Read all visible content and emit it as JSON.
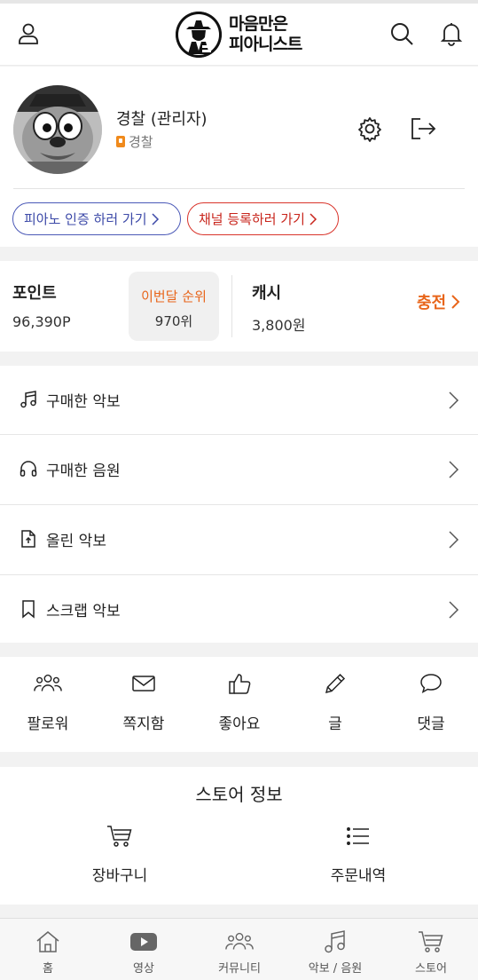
{
  "header": {
    "logo_line1": "마음만은",
    "logo_line2": "피아니스트",
    "icons": [
      "user-icon",
      "search-icon",
      "bell-icon"
    ]
  },
  "profile": {
    "name": "경찰 (관리자)",
    "role": "경찰",
    "pill_piano": "피아노 인증 하러 가기",
    "pill_channel": "채널 등록하러 가기",
    "icons": [
      "gear-icon",
      "logout-icon"
    ]
  },
  "points": {
    "point_label": "포인트",
    "point_value": "96,390P",
    "rank_label": "이번달 순위",
    "rank_value": "970위",
    "cash_label": "캐시",
    "cash_value": "3,800원",
    "charge_label": "충전"
  },
  "menu": {
    "items": [
      {
        "label": "구매한 악보",
        "icon": "music-note-icon"
      },
      {
        "label": "구매한 음원",
        "icon": "headphones-icon"
      },
      {
        "label": "올린 악보",
        "icon": "upload-file-icon"
      },
      {
        "label": "스크랩 악보",
        "icon": "bookmark-icon"
      }
    ]
  },
  "activity": {
    "items": [
      {
        "label": "팔로워",
        "icon": "followers-icon"
      },
      {
        "label": "쪽지함",
        "icon": "mail-icon"
      },
      {
        "label": "좋아요",
        "icon": "thumbs-up-icon"
      },
      {
        "label": "글",
        "icon": "pencil-icon"
      },
      {
        "label": "댓글",
        "icon": "comment-icon"
      }
    ]
  },
  "store": {
    "title": "스토어 정보",
    "items": [
      {
        "label": "장바구니",
        "icon": "cart-icon"
      },
      {
        "label": "주문내역",
        "icon": "list-icon"
      }
    ]
  },
  "bottom_nav": {
    "items": [
      {
        "label": "홈",
        "icon": "home-icon"
      },
      {
        "label": "영상",
        "icon": "video-icon"
      },
      {
        "label": "커뮤니티",
        "icon": "community-icon"
      },
      {
        "label": "악보 / 음원",
        "icon": "music-note-icon"
      },
      {
        "label": "스토어",
        "icon": "cart-icon"
      }
    ]
  },
  "colors": {
    "accent_orange": "#e8651a",
    "pill_blue": "#4b59b7",
    "pill_red": "#d9342b"
  }
}
